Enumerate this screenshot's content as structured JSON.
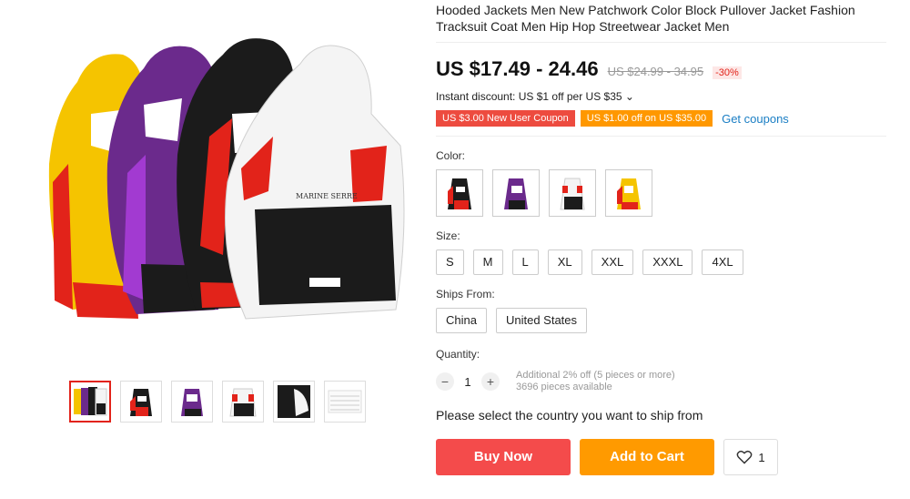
{
  "product": {
    "title": "Hooded Jackets Men New Patchwork Color Block Pullover Jacket Fashion Tracksuit Coat Men Hip Hop Streetwear Jacket Men",
    "price": "US $17.49 - 24.46",
    "old_price": "US $24.99 - 34.95",
    "discount": "-30%",
    "instant_discount": "Instant discount: US $1 off per US $35 ⌄",
    "coupons": {
      "new_user": "US $3.00 New User Coupon",
      "off": "US $1.00 off on US $35.00",
      "get": "Get coupons"
    },
    "jacket_print": "MARINE SERRE"
  },
  "color": {
    "label": "Color:",
    "swatches": [
      {
        "name": "black-red",
        "body": "#1b1b1b",
        "accent": "#e2231a"
      },
      {
        "name": "purple",
        "body": "#6b2a8c",
        "accent": "#e2231a"
      },
      {
        "name": "white",
        "body": "#f4f4f4",
        "accent": "#e2231a"
      },
      {
        "name": "yellow",
        "body": "#f5c400",
        "accent": "#e2231a"
      }
    ]
  },
  "size": {
    "label": "Size:",
    "options": [
      "S",
      "M",
      "L",
      "XL",
      "XXL",
      "XXXL",
      "4XL"
    ]
  },
  "ships_from": {
    "label": "Ships From:",
    "options": [
      "China",
      "United States"
    ]
  },
  "quantity": {
    "label": "Quantity:",
    "minus": "−",
    "value": "1",
    "plus": "+",
    "note_discount": "Additional 2% off (5 pieces or more)",
    "note_available": "3696 pieces available"
  },
  "shipping_message": "Please select the country you want to ship from",
  "actions": {
    "buy_now": "Buy Now",
    "add_to_cart": "Add to Cart",
    "wishlist_count": "1"
  },
  "colors": {
    "buy": "#f44b4b",
    "cart": "#ff9a00",
    "coupon_red": "#ed4b3f",
    "coupon_orange": "#ff9800",
    "link": "#1a7ec4"
  }
}
